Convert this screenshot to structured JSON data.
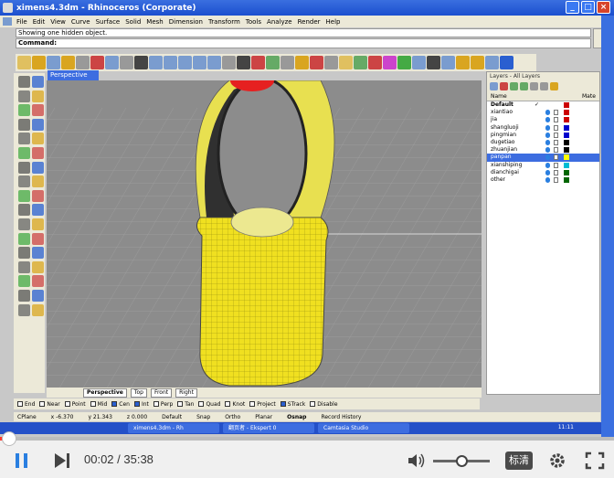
{
  "window": {
    "title": "ximens4.3dm - Rhinoceros (Corporate)",
    "min_label": "_",
    "max_label": "□",
    "close_label": "×"
  },
  "menu": {
    "items": [
      "File",
      "Edit",
      "View",
      "Curve",
      "Surface",
      "Solid",
      "Mesh",
      "Dimension",
      "Transform",
      "Tools",
      "Analyze",
      "Render",
      "Help"
    ]
  },
  "command": {
    "history": "Showing one hidden object.",
    "prompt": "Command:"
  },
  "viewport": {
    "active_label": "Perspective",
    "tabs": [
      "Perspective",
      "Top",
      "Front",
      "Right"
    ]
  },
  "layers": {
    "title": "Layers - All Layers",
    "col_name": "Name",
    "col_mat": "Mate",
    "rows": [
      {
        "name": "Default",
        "current": true,
        "color": "#cc0000",
        "bold": true
      },
      {
        "name": "xiantiao",
        "color": "#cc0000"
      },
      {
        "name": "jia",
        "color": "#cc0000"
      },
      {
        "name": "shangluoji",
        "color": "#0000cc"
      },
      {
        "name": "pingmian",
        "color": "#0000cc"
      },
      {
        "name": "dugetiao",
        "color": "#000000"
      },
      {
        "name": "zhuanjian",
        "color": "#000000"
      },
      {
        "name": "panpan",
        "color": "#ffff00",
        "selected": true
      },
      {
        "name": "xianshiping",
        "color": "#00bcd4"
      },
      {
        "name": "dianchigai",
        "color": "#006600"
      },
      {
        "name": "other",
        "color": "#006600"
      }
    ],
    "current_mark": "✓"
  },
  "osnap": {
    "items": [
      {
        "label": "End",
        "checked": false
      },
      {
        "label": "Near",
        "checked": false
      },
      {
        "label": "Point",
        "checked": false
      },
      {
        "label": "Mid",
        "checked": false
      },
      {
        "label": "Cen",
        "checked": true
      },
      {
        "label": "Int",
        "checked": true
      },
      {
        "label": "Perp",
        "checked": false
      },
      {
        "label": "Tan",
        "checked": false
      },
      {
        "label": "Quad",
        "checked": false
      },
      {
        "label": "Knot",
        "checked": false
      },
      {
        "label": "Project",
        "checked": false
      },
      {
        "label": "STrack",
        "checked": true
      },
      {
        "label": "Disable",
        "checked": false
      }
    ]
  },
  "status": {
    "cplane": "CPlane",
    "x": "x -6.370",
    "y": "y 21.343",
    "z": "z 0.000",
    "layer": "Default",
    "toggles": [
      "Snap",
      "Ortho",
      "Planar",
      "Osnap",
      "Record History"
    ]
  },
  "taskbar": {
    "tasks": [
      "ximens4.3dm - Rh",
      "翻页者 - Ekspert 0",
      "Camtasia Studio"
    ],
    "clock": "11:11"
  },
  "player": {
    "current": "00:02",
    "duration": "35:38",
    "time_text": "00:02 / 35:38",
    "quality": "标清",
    "progress": 0.001,
    "volume": 0.5
  },
  "colors": {
    "accent": "#3d6de0",
    "model_yellow": "#f0e020",
    "seek_red": "#ff3a2e"
  }
}
